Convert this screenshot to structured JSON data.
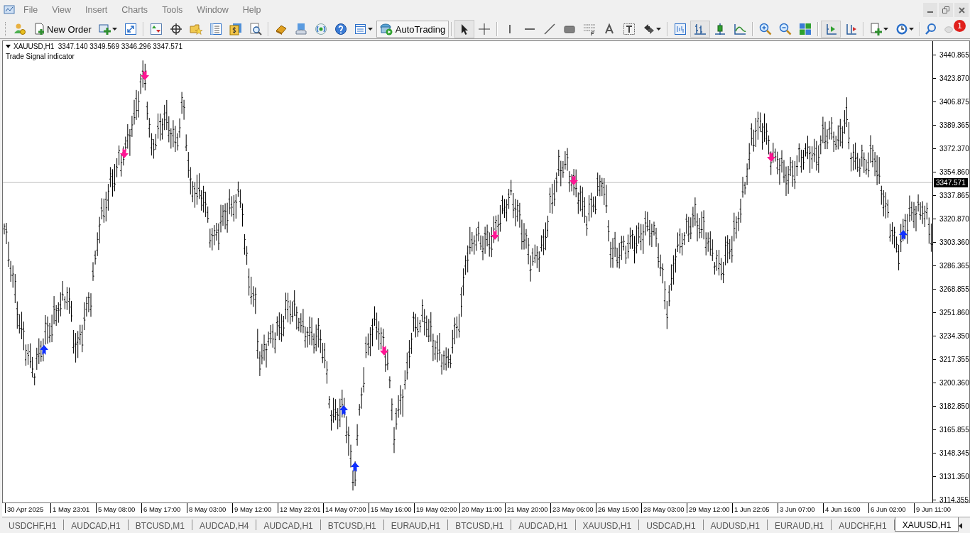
{
  "menu_bar": {
    "items": [
      "File",
      "View",
      "Insert",
      "Charts",
      "Tools",
      "Window",
      "Help"
    ]
  },
  "toolbar": {
    "new_order": "New Order",
    "auto_trading": "AutoTrading",
    "chart_types": [
      {
        "kind": "bars",
        "selected": true
      },
      {
        "kind": "candles",
        "selected": false
      },
      {
        "kind": "line",
        "selected": false
      }
    ],
    "scroll_buttons": [
      {
        "kind": "auto-scroll",
        "on": true
      },
      {
        "kind": "chart-shift",
        "on": false
      }
    ],
    "notification_count": "1"
  },
  "chart": {
    "symbol_line": "XAUUSD,H1  3347.140 3349.569 3346.296 3347.571",
    "indicator": "Trade Signal indicator",
    "price_axis": {
      "labels": [
        "3440.865",
        "3423.870",
        "3406.875",
        "3389.365",
        "3372.370",
        "3354.860",
        "3337.865",
        "3320.870",
        "3303.360",
        "3286.365",
        "3268.855",
        "3251.860",
        "3234.350",
        "3217.355",
        "3200.360",
        "3182.850",
        "3165.855",
        "3148.345",
        "3131.350",
        "3114.355"
      ],
      "current": "3347.571"
    },
    "time_axis": [
      "30 Apr 2025",
      "1 May 23:01",
      "5 May 08:00",
      "6 May 17:00",
      "8 May 03:00",
      "9 May 12:00",
      "12 May 22:01",
      "14 May 07:00",
      "15 May 16:00",
      "19 May 02:00",
      "20 May 11:00",
      "21 May 20:00",
      "23 May 06:00",
      "26 May 15:00",
      "28 May 03:00",
      "29 May 12:00",
      "1 Jun 22:05",
      "3 Jun 07:00",
      "4 Jun 16:00",
      "6 Jun 02:00",
      "9 Jun 11:00"
    ]
  },
  "tabs": [
    {
      "label": "USDCHF,H1",
      "selected": false
    },
    {
      "label": "AUDCAD,H1",
      "selected": false
    },
    {
      "label": "BTCUSD,M1",
      "selected": false
    },
    {
      "label": "AUDCAD,H4",
      "selected": false
    },
    {
      "label": "AUDCAD,H1",
      "selected": false
    },
    {
      "label": "BTCUSD,H1",
      "selected": false
    },
    {
      "label": "EURAUD,H1",
      "selected": false
    },
    {
      "label": "BTCUSD,H1",
      "selected": false
    },
    {
      "label": "AUDCAD,H1",
      "selected": false
    },
    {
      "label": "XAUUSD,H1",
      "selected": false
    },
    {
      "label": "USDCAD,H1",
      "selected": false
    },
    {
      "label": "AUDUSD,H1",
      "selected": false
    },
    {
      "label": "EURAUD,H1",
      "selected": false
    },
    {
      "label": "AUDCHF,H1",
      "selected": false
    },
    {
      "label": "XAUUSD,H1",
      "selected": true
    }
  ]
}
